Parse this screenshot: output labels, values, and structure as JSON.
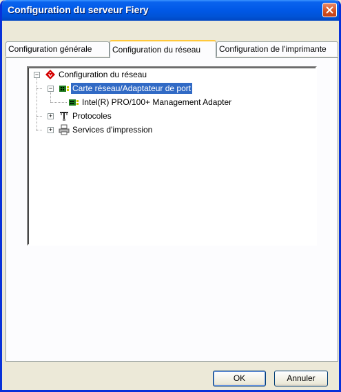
{
  "window": {
    "title": "Configuration du serveur Fiery"
  },
  "tabs": [
    {
      "label": "Configuration générale"
    },
    {
      "label": "Configuration du réseau"
    },
    {
      "label": "Configuration de l'imprimante"
    }
  ],
  "active_tab": "Configuration du réseau",
  "tree": {
    "root": {
      "label": "Configuration du réseau",
      "icon": "fiery-logo-icon",
      "expanded": true
    },
    "adapter": {
      "label": "Carte réseau/Adaptateur de port",
      "icon": "network-card-icon",
      "expanded": true,
      "selected": true
    },
    "adapter_child": {
      "label": "Intel(R) PRO/100+ Management Adapter",
      "icon": "network-card-icon"
    },
    "protocols": {
      "label": "Protocoles",
      "icon": "network-connector-icon",
      "expanded": false
    },
    "print_services": {
      "label": "Services d'impression",
      "icon": "printer-icon",
      "expanded": false
    },
    "expander_plus": "+",
    "expander_minus": "−"
  },
  "buttons": {
    "ok": "OK",
    "cancel": "Annuler"
  },
  "colors": {
    "title_bar": "#0058e6",
    "selection": "#316ac5",
    "window_bg": "#ece9d8",
    "active_tab_accent": "#ffc83c"
  }
}
